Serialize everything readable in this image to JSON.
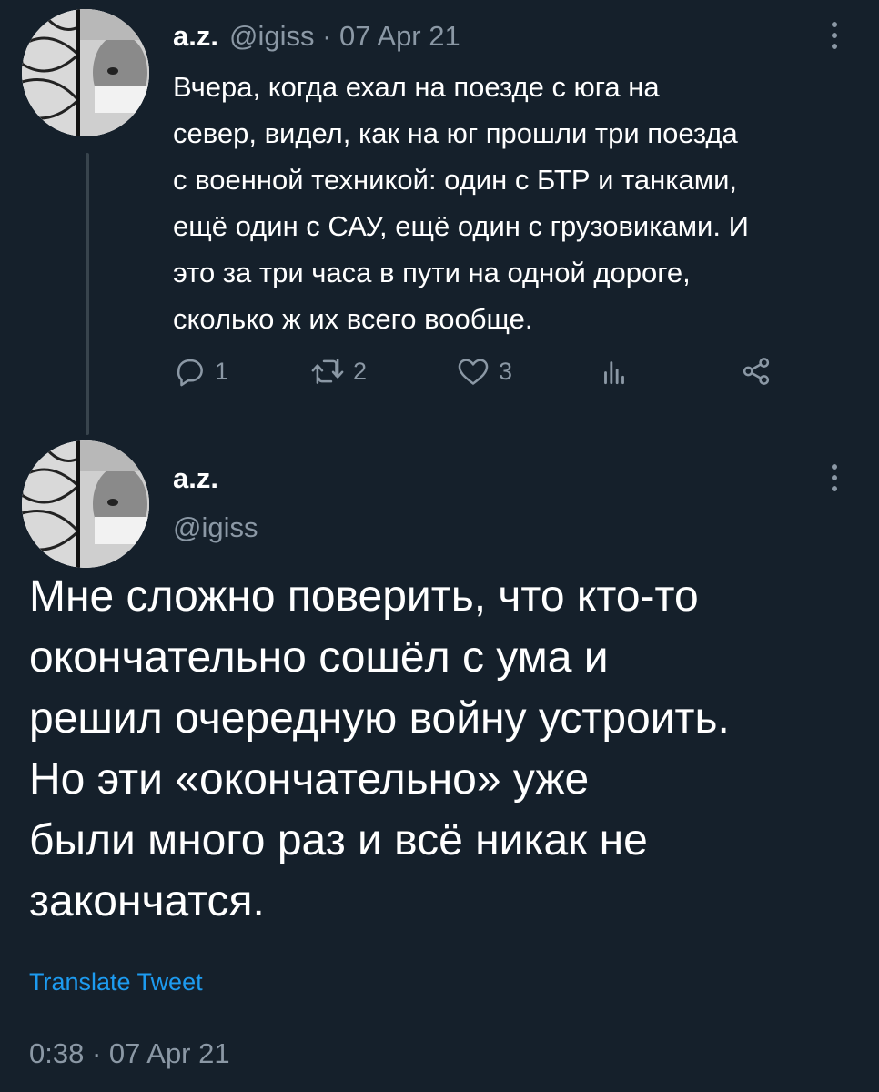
{
  "parent_tweet": {
    "name": "a.z.",
    "meta": "@igiss · 07 Apr 21",
    "text": "Вчера, когда ехал на поезде с юга на\nсевер, видел, как на юг прошли три поезда\nс военной техникой: один с БТР и танками,\nещё один с САУ, ещё один с грузовиками. И\nэто за три часа в пути на одной дороге,\nсколько ж их всего вообще.",
    "actions": {
      "reply_count": "1",
      "retweet_count": "2",
      "like_count": "3"
    },
    "icons": [
      "more-icon",
      "reply-icon",
      "retweet-icon",
      "like-icon",
      "analytics-icon",
      "share-icon"
    ]
  },
  "main_tweet": {
    "name": "a.z.",
    "handle": "@igiss",
    "text": "Мне сложно поверить, что кто-то\nокончательно сошёл с ума и\nрешил очередную войну устроить.\nНо эти «окончательно» уже\nбыли много раз и всё никак не\nзакончатся.",
    "translate_label": "Translate Tweet",
    "timestamp": "0:38 · 07 Apr 21"
  },
  "colors": {
    "background": "#15202b",
    "text_primary": "#ffffff",
    "text_secondary": "#8b98a5",
    "accent": "#1d9bf0",
    "thread_line": "#38444d"
  }
}
